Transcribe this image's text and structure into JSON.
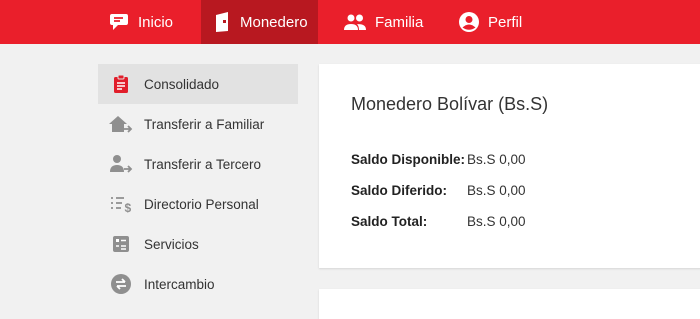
{
  "nav": {
    "items": [
      {
        "label": "Inicio",
        "icon": "chat-logo-icon"
      },
      {
        "label": "Monedero",
        "icon": "wallet-icon",
        "active": true
      },
      {
        "label": "Familia",
        "icon": "people-icon"
      },
      {
        "label": "Perfil",
        "icon": "account-circle-icon"
      }
    ],
    "bar_color": "#ea1f2b",
    "active_color": "#b81820"
  },
  "sidebar": {
    "items": [
      {
        "label": "Consolidado",
        "icon": "clipboard-icon",
        "active": true
      },
      {
        "label": "Transferir a Familiar",
        "icon": "house-transfer-icon"
      },
      {
        "label": "Transferir a Tercero",
        "icon": "person-transfer-icon"
      },
      {
        "label": "Directorio Personal",
        "icon": "list-money-icon"
      },
      {
        "label": "Servicios",
        "icon": "services-icon"
      },
      {
        "label": "Intercambio",
        "icon": "exchange-icon"
      }
    ],
    "accent_color": "#e11d2a"
  },
  "wallet": {
    "title": "Monedero Bolívar (Bs.S)",
    "balances": [
      {
        "label": "Saldo Disponible:",
        "value": "Bs.S 0,00"
      },
      {
        "label": "Saldo Diferido:",
        "value": "Bs.S 0,00"
      },
      {
        "label": "Saldo Total:",
        "value": "Bs.S 0,00"
      }
    ]
  }
}
